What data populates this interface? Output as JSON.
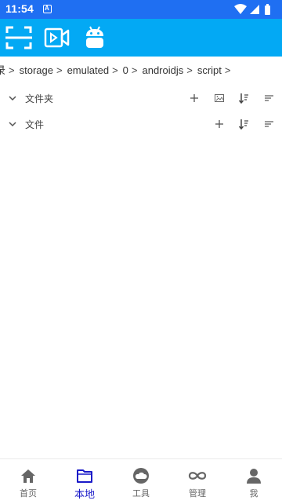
{
  "status_bar": {
    "time": "11:54",
    "app_icon": "A",
    "icons": [
      "wifi-icon",
      "signal-icon",
      "battery-icon"
    ]
  },
  "toolbar": {
    "icons": [
      "scan-icon",
      "video-icon",
      "android-icon"
    ],
    "background": "#03a9f4"
  },
  "breadcrumb": [
    {
      "label": "录"
    },
    {
      "label": "storage"
    },
    {
      "label": "emulated"
    },
    {
      "label": "0"
    },
    {
      "label": "androidjs"
    },
    {
      "label": "script"
    }
  ],
  "breadcrumb_sep": ">",
  "sections": {
    "folders": {
      "title": "文件夹",
      "actions": [
        "add-icon",
        "image-icon",
        "sort-icon",
        "filter-icon"
      ]
    },
    "files": {
      "title": "文件",
      "actions": [
        "add-icon",
        "sort-icon",
        "filter-icon"
      ]
    }
  },
  "bottom_nav": {
    "items": [
      {
        "label": "首页",
        "icon": "home-icon"
      },
      {
        "label": "本地",
        "icon": "folder-icon",
        "active": true
      },
      {
        "label": "工具",
        "icon": "cloud-icon"
      },
      {
        "label": "管理",
        "icon": "infinity-icon"
      },
      {
        "label": "我",
        "icon": "person-icon"
      }
    ],
    "active_color": "#1a1ac8"
  },
  "colors": {
    "status_bar": "#1f6ff2",
    "toolbar": "#03a9f4"
  }
}
